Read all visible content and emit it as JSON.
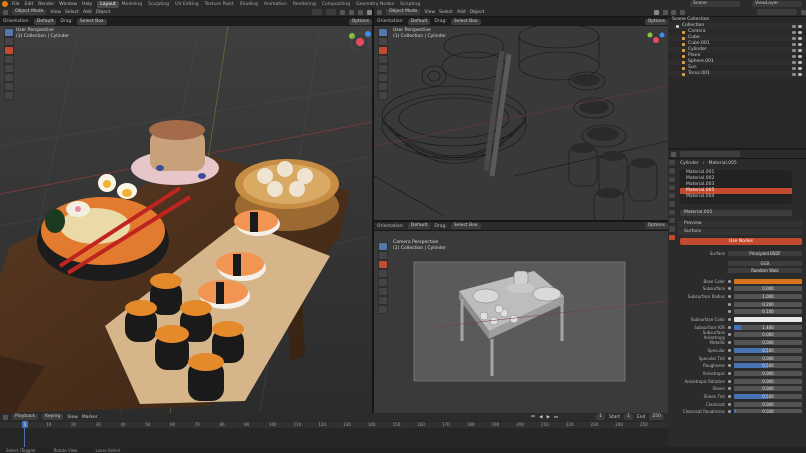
{
  "topbar": {
    "menus": [
      "File",
      "Edit",
      "Render",
      "Window",
      "Help"
    ],
    "workspaces": [
      "Layout",
      "Modeling",
      "Sculpting",
      "UV Editing",
      "Texture Paint",
      "Shading",
      "Animation",
      "Rendering",
      "Compositing",
      "Geometry Nodes",
      "Scripting"
    ],
    "active_workspace": "Layout",
    "scene": "Scene",
    "view_layer": "ViewLayer"
  },
  "viewport_left": {
    "mode": "Object Mode",
    "menus": [
      "View",
      "Select",
      "Add",
      "Object"
    ],
    "orientation_label": "Orientation:",
    "orientation": "Default",
    "drag_label": "Drag:",
    "drag": "Select Box",
    "options": "Options",
    "overlay_line1": "User Perspective",
    "overlay_line2": "(1) Collection | Cylinder"
  },
  "viewport_top_right": {
    "mode": "Object Mode",
    "menus": [
      "View",
      "Select",
      "Add",
      "Object"
    ],
    "orientation_label": "Orientation:",
    "orientation": "Default",
    "drag_label": "Drag:",
    "drag": "Select Box",
    "options": "Options",
    "overlay_line1": "User Perspective",
    "overlay_line2": "(1) Collection | Cylinder"
  },
  "viewport_bottom_right": {
    "mode": "Object Mode",
    "menus": [
      "View",
      "Select",
      "Add",
      "Object"
    ],
    "orientation_label": "Orientation:",
    "orientation": "Default",
    "drag_label": "Drag:",
    "drag": "Select Box",
    "options": "Options",
    "overlay_line1": "Camera Perspective",
    "overlay_line2": "(1) Collection | Cylinder"
  },
  "outliner": {
    "title": "Scene Collection",
    "items": [
      "Collection",
      "Camera",
      "Cube",
      "Cube.001",
      "Cylinder",
      "Plane",
      "Sphere.001",
      "Sun",
      "Torus.001"
    ]
  },
  "properties": {
    "object_name": "Cylinder",
    "material_name": "Material.005",
    "materials": [
      "Material.001",
      "Material.002",
      "Material.003",
      "Material.004",
      "Material.005"
    ],
    "active_material": "Material.005",
    "slot_name": "Material.005",
    "section_preview": "Preview",
    "section_surface": "Surface",
    "use_nodes": "Use Nodes",
    "surface_label": "Surface",
    "surface_value": "Principled BSDF",
    "dist": "GGX",
    "sss": "Random Walk",
    "rows": [
      {
        "label": "Base Color",
        "value": "",
        "color": "#d8741e"
      },
      {
        "label": "Subsurface",
        "value": "0.000",
        "fill": 0
      },
      {
        "label": "Subsurface Radius",
        "value": "1.000",
        "fill": 0
      },
      {
        "label": "",
        "value": "0.200",
        "fill": 0
      },
      {
        "label": "",
        "value": "0.100",
        "fill": 0
      },
      {
        "label": "Subsurface Color",
        "value": "",
        "color": "#e8e8e8"
      },
      {
        "label": "Subsurface IOR",
        "value": "1.400",
        "fill": 0.1
      },
      {
        "label": "Subsurface Anisotropy",
        "value": "0.000",
        "fill": 0
      },
      {
        "label": "Metallic",
        "value": "0.000",
        "fill": 0
      },
      {
        "label": "Specular",
        "value": "0.500",
        "fill": 0.5
      },
      {
        "label": "Specular Tint",
        "value": "0.000",
        "fill": 0
      },
      {
        "label": "Roughness",
        "value": "0.500",
        "fill": 0.5
      },
      {
        "label": "Anisotropic",
        "value": "0.000",
        "fill": 0
      },
      {
        "label": "Anisotropic Rotation",
        "value": "0.000",
        "fill": 0
      },
      {
        "label": "Sheen",
        "value": "0.000",
        "fill": 0
      },
      {
        "label": "Sheen Tint",
        "value": "0.500",
        "fill": 0.5
      },
      {
        "label": "Clearcoat",
        "value": "0.000",
        "fill": 0
      },
      {
        "label": "Clearcoat Roughness",
        "value": "0.030",
        "fill": 0.03
      },
      {
        "label": "IOR",
        "value": "1.450",
        "fill": 0
      },
      {
        "label": "Transmission",
        "value": "0.000",
        "fill": 0
      },
      {
        "label": "Transmission Roughness",
        "value": "0.000",
        "fill": 0
      },
      {
        "label": "Emission",
        "value": "",
        "color": "#111111"
      }
    ]
  },
  "timeline": {
    "playback": "Playback",
    "keying": "Keying",
    "view": "View",
    "marker": "Marker",
    "current_frame": "1",
    "start_label": "Start",
    "start": "1",
    "end_label": "End",
    "end": "250",
    "ticks": [
      "1",
      "10",
      "20",
      "30",
      "40",
      "50",
      "60",
      "70",
      "80",
      "90",
      "100",
      "110",
      "120",
      "130",
      "140",
      "150",
      "160",
      "170",
      "180",
      "190",
      "200",
      "210",
      "220",
      "230",
      "240",
      "250"
    ]
  },
  "statusbar": [
    "Select (Toggle)",
    "Rotate View",
    "Lasso Select"
  ]
}
